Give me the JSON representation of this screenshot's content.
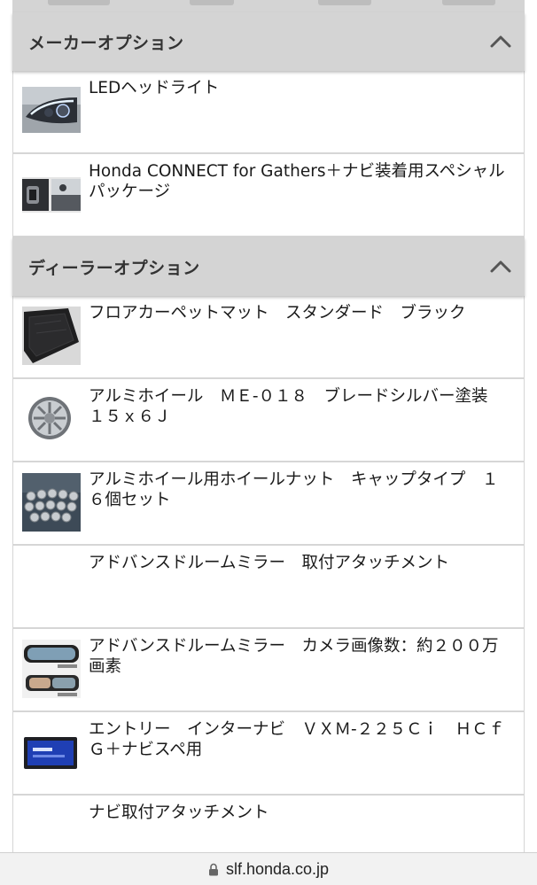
{
  "maker_options": {
    "title": "メーカーオプション",
    "items": [
      {
        "name": "LEDヘッドライト",
        "icon": "headlight-thumbnail"
      },
      {
        "name": "Honda CONNECT for Gathers＋ナビ装着用スペシャルパッケージ",
        "icon": "connect-package-thumbnail"
      }
    ]
  },
  "dealer_options": {
    "title": "ディーラーオプション",
    "items": [
      {
        "name": "フロアカーペットマット　スタンダード　ブラック",
        "icon": "floor-mat-thumbnail"
      },
      {
        "name": "アルミホイール　ＭＥ-０１８　ブレードシルバー塗装　１５ｘ６Ｊ",
        "icon": "alloy-wheel-thumbnail"
      },
      {
        "name": "アルミホイール用ホイールナット　キャップタイプ　１６個セット",
        "icon": "wheel-nuts-thumbnail"
      },
      {
        "name": "アドバンスドルームミラー　取付アタッチメント",
        "icon": ""
      },
      {
        "name": "アドバンスドルームミラー　カメラ画像数：約２００万画素",
        "icon": "mirror-camera-thumbnail"
      },
      {
        "name": "エントリー　インターナビ　ＶＸＭ-２２５Ｃｉ　ＨＣｆＧ＋ナビスペ用",
        "icon": "navi-thumbnail"
      },
      {
        "name": "ナビ取付アタッチメント",
        "icon": ""
      }
    ]
  },
  "browser": {
    "url": "slf.honda.co.jp",
    "icon": "lock-icon"
  }
}
